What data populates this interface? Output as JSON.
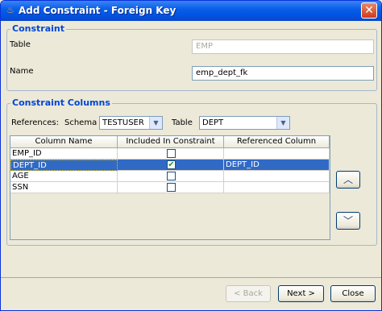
{
  "window": {
    "title": "Add Constraint - Foreign Key",
    "app_icon": "java-cup-icon",
    "close_glyph": "✕"
  },
  "constraint": {
    "legend": "Constraint",
    "table_label": "Table",
    "table_value": "EMP",
    "name_label": "Name",
    "name_value": "emp_dept_fk"
  },
  "columns": {
    "legend": "Constraint Columns",
    "references_label": "References:",
    "schema_label": "Schema",
    "schema_value": "TESTUSER",
    "table_label": "Table",
    "table_value": "DEPT",
    "headers": [
      "Column Name",
      "Included In Constraint",
      "Referenced Column"
    ],
    "rows": [
      {
        "name": "EMP_ID",
        "included": false,
        "referenced": ""
      },
      {
        "name": "DEPT_ID",
        "included": true,
        "referenced": "DEPT_ID"
      },
      {
        "name": "AGE",
        "included": false,
        "referenced": ""
      },
      {
        "name": "SSN",
        "included": false,
        "referenced": ""
      }
    ],
    "selected_row": 1
  },
  "buttons": {
    "move_up_glyph": "︿",
    "move_down_glyph": "﹀",
    "back": "< Back",
    "next": "Next >",
    "close": "Close"
  }
}
